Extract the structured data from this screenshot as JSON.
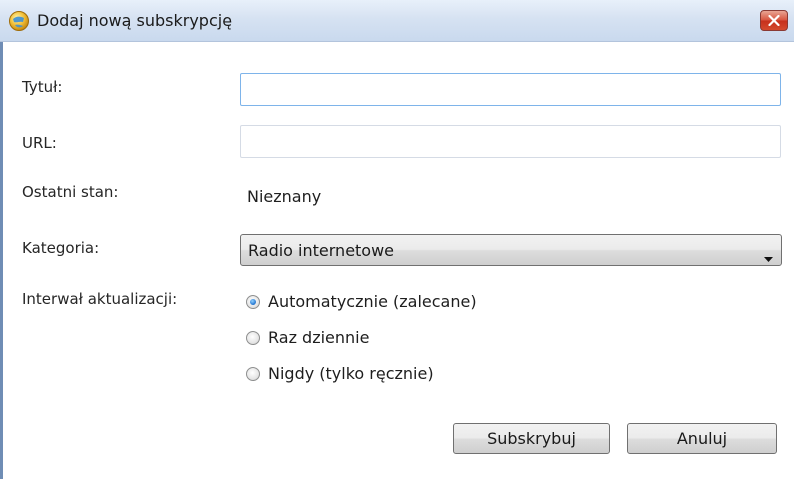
{
  "window": {
    "title": "Dodaj nową subskrypcję",
    "icon": "app-globe-icon",
    "close_icon": "close-x-icon",
    "close_color": "#d44a2e"
  },
  "form": {
    "title_label": "Tytuł:",
    "title_value": "",
    "url_label": "URL:",
    "url_value": "",
    "status_label": "Ostatni stan:",
    "status_value": "Nieznany",
    "category_label": "Kategoria:",
    "category_selected": "Radio internetowe",
    "interval_label": "Interwał aktualizacji:",
    "interval_options": [
      {
        "label": "Automatycznie (zalecane)",
        "checked": true
      },
      {
        "label": "Raz dziennie",
        "checked": false
      },
      {
        "label": "Nigdy (tylko ręcznie)",
        "checked": false
      }
    ]
  },
  "buttons": {
    "subscribe_label": "Subskrybuj",
    "cancel_label": "Anuluj"
  },
  "colors": {
    "focus_border": "#7eb4ea",
    "radio_accent": "#2f7fd6"
  }
}
